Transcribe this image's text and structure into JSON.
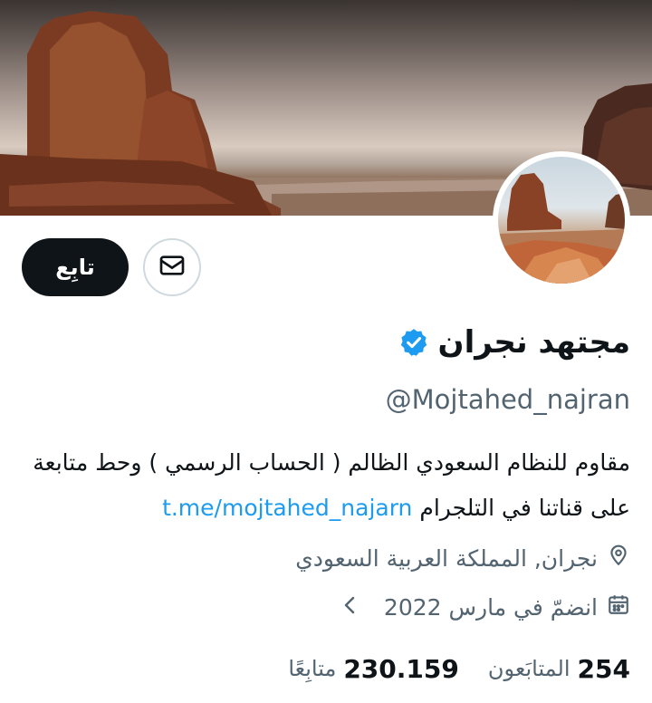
{
  "profile": {
    "display_name": "مجتهد نجران",
    "handle": "@Mojtahed_najran",
    "bio_text": "مقاوم للنظام السعودي الظالم ( الحساب الرسمي ) وحط متابعة على قناتنا في التلجرام",
    "bio_link": "t.me/mojtahed_najarn",
    "location": "نجران, المملكة العربية السعودي",
    "joined": "انضمّ في مارس 2022"
  },
  "actions": {
    "follow_label": "تابِع"
  },
  "stats": {
    "following_count": "254",
    "following_label": "المتابَعون",
    "followers_count": "230.159",
    "followers_label": "متابِعًا"
  },
  "icons": {
    "verified": "verified-badge-icon",
    "message": "envelope-icon",
    "location": "location-pin-icon",
    "calendar": "calendar-icon",
    "chevron": "chevron-left-icon"
  },
  "colors": {
    "accent": "#1d9bf0",
    "text_primary": "#0f1419",
    "text_secondary": "#536471",
    "button_dark": "#0f1419"
  }
}
